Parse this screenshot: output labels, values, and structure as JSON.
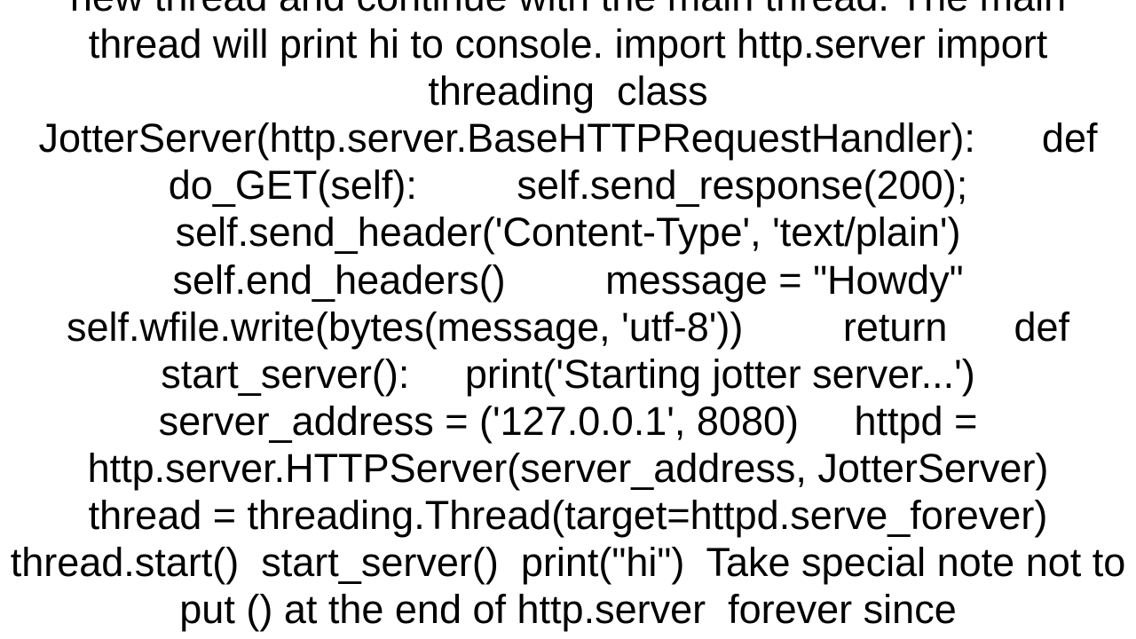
{
  "content": {
    "body_text": "new thread and continue with the main thread. The main thread will print hi to console. import http.server import threading  class JotterServer(http.server.BaseHTTPRequestHandler):      def do_GET(self):         self.send_response(200);         self.send_header('Content-Type', 'text/plain')         self.end_headers()         message = \"Howdy\"         self.wfile.write(bytes(message, 'utf-8'))         return      def start_server():     print('Starting jotter server...')     server_address = ('127.0.0.1', 8080)     httpd = http.server.HTTPServer(server_address, JotterServer)     thread = threading.Thread(target=httpd.serve_forever)     thread.start()  start_server()  print(\"hi\")  Take special note not to put () at the end of http.server  forever since"
  }
}
